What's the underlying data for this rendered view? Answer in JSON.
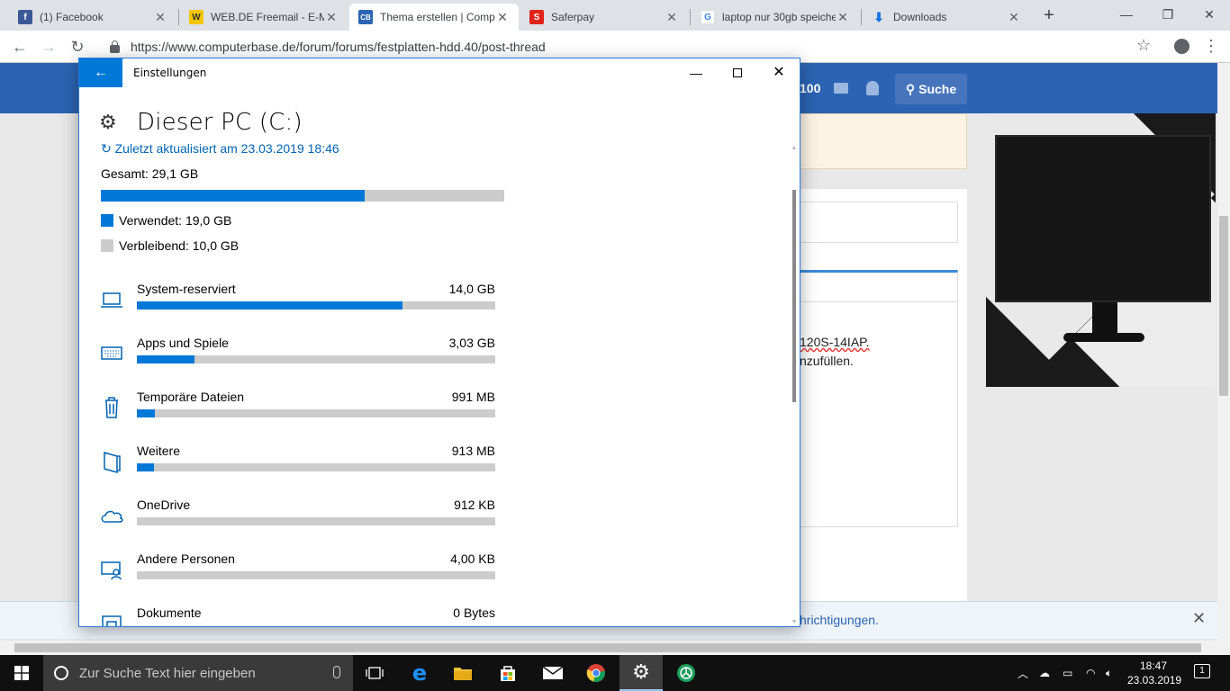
{
  "browser": {
    "tabs": [
      {
        "title": "(1) Facebook",
        "icon": "facebook-icon",
        "color": "#3b5998",
        "glyph": "f"
      },
      {
        "title": "WEB.DE Freemail - E-Mail",
        "icon": "webde-icon",
        "color": "#f5c400",
        "glyph": "W"
      },
      {
        "title": "Thema erstellen | Comp",
        "icon": "computerbase-icon",
        "color": "#2c64b3",
        "glyph": "CB"
      },
      {
        "title": "Saferpay",
        "icon": "saferpay-icon",
        "color": "#e2231a",
        "glyph": "S"
      },
      {
        "title": "laptop nur 30gb speiche",
        "icon": "google-icon",
        "color": "#4285f4",
        "glyph": "G"
      },
      {
        "title": "Downloads",
        "icon": "download-icon",
        "color": "#1a73e8",
        "glyph": "↓"
      }
    ],
    "url": "https://www.computerbase.de/forum/forums/festplatten-hdd.40/post-thread"
  },
  "website": {
    "header_count": "100",
    "search_label": "Suche",
    "editor_line1": "120S-14IAP.",
    "editor_line2": "nzufüllen.",
    "cookie_text": "hrichtigungen."
  },
  "settings": {
    "window_title": "Einstellungen",
    "heading": "Dieser PC (C:)",
    "updated": "↻ Zuletzt aktualisiert am 23.03.2019 18:46",
    "total": "Gesamt: 29,1 GB",
    "used_label": "Verwendet: 19,0 GB",
    "free_label": "Verbleibend: 10,0 GB",
    "used_fraction": 0.653,
    "categories": [
      {
        "name": "System-reserviert",
        "size": "14,0 GB",
        "fraction": 0.74,
        "icon": "laptop-icon"
      },
      {
        "name": "Apps und Spiele",
        "size": "3,03 GB",
        "fraction": 0.16,
        "icon": "keyboard-icon"
      },
      {
        "name": "Temporäre Dateien",
        "size": "991 MB",
        "fraction": 0.05,
        "icon": "trash-icon"
      },
      {
        "name": "Weitere",
        "size": "913 MB",
        "fraction": 0.048,
        "icon": "folder-icon"
      },
      {
        "name": "OneDrive",
        "size": "912 KB",
        "fraction": 0.0,
        "icon": "cloud-icon"
      },
      {
        "name": "Andere Personen",
        "size": "4,00 KB",
        "fraction": 0.0,
        "icon": "people-icon"
      },
      {
        "name": "Dokumente",
        "size": "0 Bytes",
        "fraction": 0.0,
        "icon": "documents-icon"
      }
    ]
  },
  "taskbar": {
    "search_placeholder": "Zur Suche Text hier eingeben",
    "time": "18:47",
    "date": "23.03.2019",
    "notification_count": "1"
  },
  "colors": {
    "accent": "#0078d7",
    "bar_bg": "#cccccc",
    "site_blue": "#2c64b3"
  }
}
